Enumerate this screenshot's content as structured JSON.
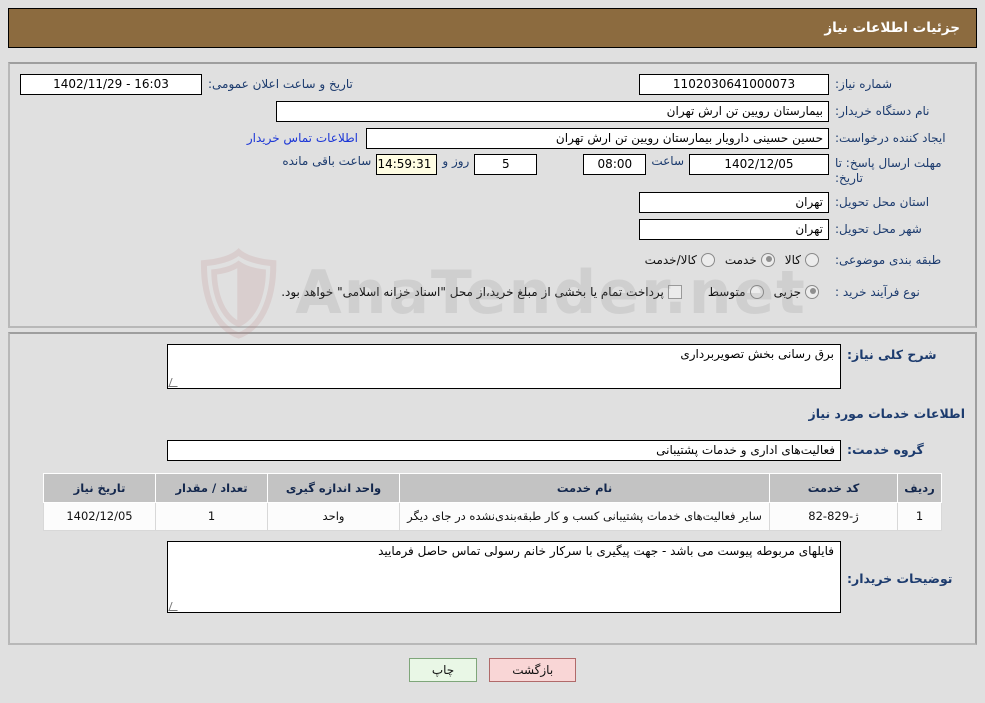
{
  "header": {
    "title": "جزئیات اطلاعات نیاز",
    "bg_color": "#8C6B3F"
  },
  "watermark": {
    "text": "AnaTender.net"
  },
  "form": {
    "need_number_label": "شماره نیاز:",
    "need_number_value": "1102030641000073",
    "announce_label": "تاریخ و ساعت اعلان عمومی:",
    "announce_value": "16:03 - 1402/11/29",
    "buyer_org_label": "نام دستگاه خریدار:",
    "buyer_org_value": "بیمارستان رویین تن ارش تهران",
    "creator_label": "ایجاد کننده درخواست:",
    "creator_value": "حسین حسینی دارویار بیمارستان رویین تن ارش تهران",
    "contact_link": "اطلاعات تماس خریدار",
    "deadline_label": "مهلت ارسال پاسخ: تا تاریخ:",
    "deadline_date": "1402/12/05",
    "deadline_hour_label": "ساعت",
    "deadline_time": "08:00",
    "remaining_days": "5",
    "remaining_days_label": "روز و",
    "remaining_time": "14:59:31",
    "remaining_time_label": "ساعت باقی مانده",
    "province_label": "استان محل تحویل:",
    "province_value": "تهران",
    "city_label": "شهر محل تحویل:",
    "city_value": "تهران",
    "category_label": "طبقه بندی موضوعی:",
    "category_options": [
      {
        "label": "کالا",
        "selected": false
      },
      {
        "label": "خدمت",
        "selected": true
      },
      {
        "label": "کالا/خدمت",
        "selected": false
      }
    ],
    "process_label": "نوع فرآیند خرید :",
    "process_options": [
      {
        "label": "جزیی",
        "selected": true
      },
      {
        "label": "متوسط",
        "selected": false
      }
    ],
    "treasury_checkbox_label": "پرداخت تمام یا بخشی از مبلغ خرید،از محل \"اسناد خزانه اسلامی\" خواهد بود.",
    "treasury_checked": false
  },
  "details": {
    "general_desc_label": "شرح کلی نیاز:",
    "general_desc_value": "برق رسانی بخش تصویربرداری",
    "services_section_title": "اطلاعات خدمات مورد نیاز",
    "service_group_label": "گروه خدمت:",
    "service_group_value": "فعالیت‌های اداری و خدمات پشتیبانی",
    "buyer_notes_label": "توضیحات خریدار:",
    "buyer_notes_value": "فایلهای مربوطه پیوست می باشد - جهت پیگیری با سرکار خانم رسولی تماس حاصل فرمایید"
  },
  "table": {
    "columns": [
      "ردیف",
      "کد خدمت",
      "نام خدمت",
      "واحد اندازه گیری",
      "تعداد / مقدار",
      "تاریخ نیاز"
    ],
    "rows": [
      {
        "index": "1",
        "code": "ژ-829-82",
        "name": "سایر فعالیت‌های خدمات پشتیبانی کسب و کار طبقه‌بندی‌نشده در جای دیگر",
        "unit": "واحد",
        "quantity": "1",
        "date": "1402/12/05"
      }
    ]
  },
  "buttons": {
    "print": "چاپ",
    "back": "بازگشت"
  }
}
